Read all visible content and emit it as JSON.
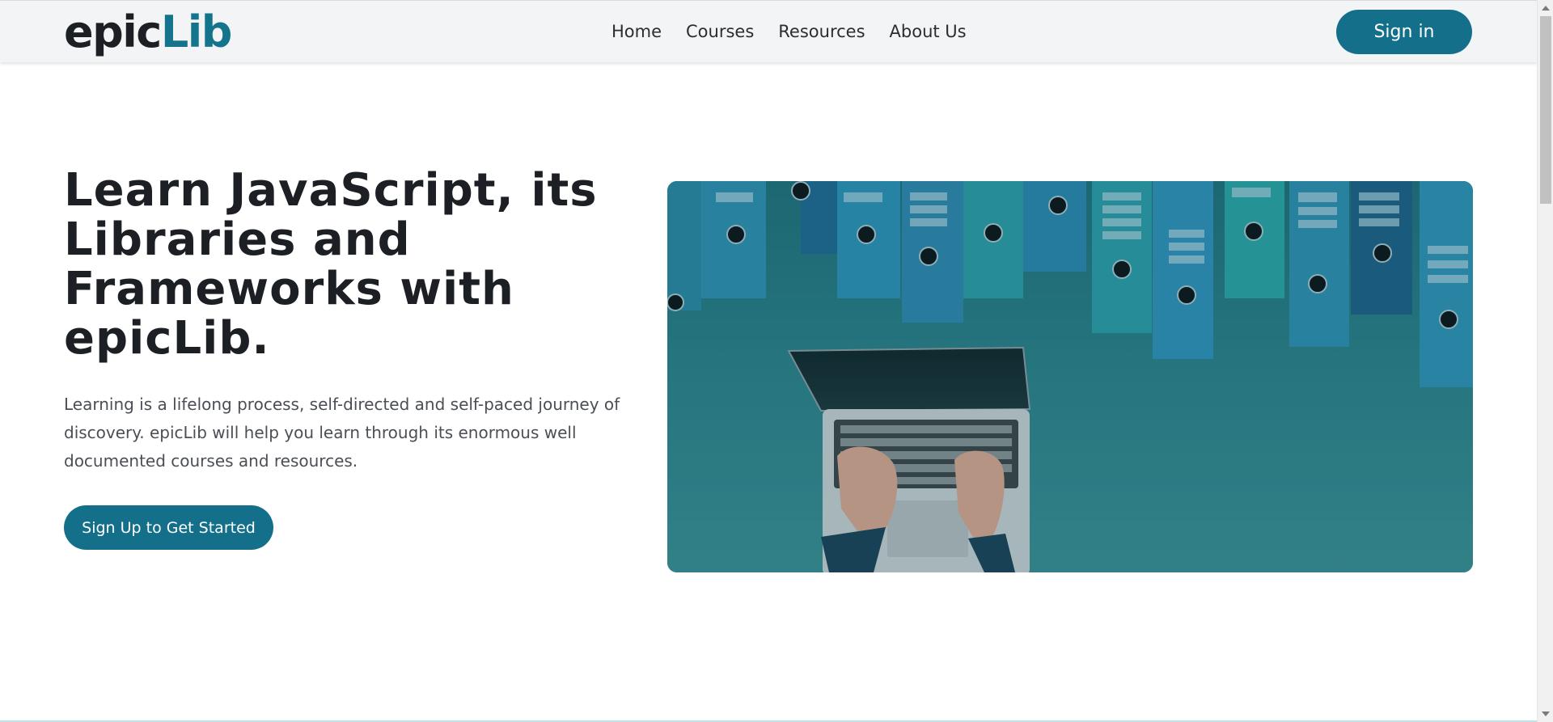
{
  "brand": {
    "part1": "epic",
    "part2": "Lib"
  },
  "nav": {
    "links": [
      "Home",
      "Courses",
      "Resources",
      "About Us"
    ],
    "signin_label": "Sign in"
  },
  "hero": {
    "title": "Learn JavaScript, its Libraries and Frameworks with epicLib.",
    "description": "Learning is a lifelong process, self-directed and self-paced journey of discovery. epicLib will help you learn through its enormous well documented courses and resources.",
    "cta_label": "Sign Up to Get Started",
    "image_icon": "laptop-binders-photo"
  },
  "colors": {
    "brand_accent": "#14748c",
    "button_bg": "#14708a",
    "navbar_bg": "#f3f4f6",
    "text_dark": "#1c1f23"
  }
}
